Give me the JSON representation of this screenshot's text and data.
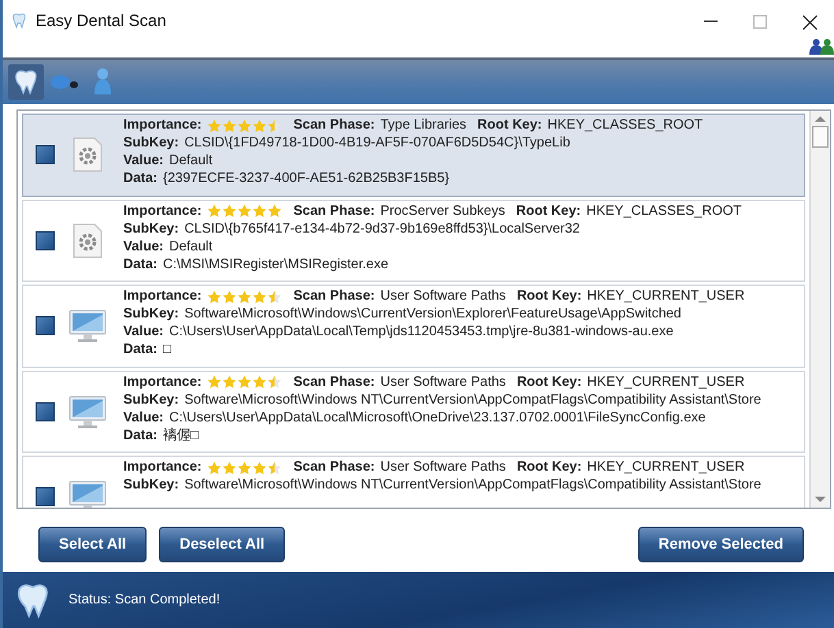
{
  "window": {
    "title": "Easy Dental Scan"
  },
  "toolbar": {
    "tabs": [
      {
        "selected": true
      },
      {
        "selected": false
      },
      {
        "selected": false
      }
    ]
  },
  "results": [
    {
      "selected": true,
      "lines": [
        [
          {
            "kind": "rating",
            "label": "Importance:",
            "stars": 4.5
          },
          {
            "kind": "text",
            "label": "Scan Phase:",
            "value": "Type Libraries"
          },
          {
            "kind": "text",
            "label": "Root Key:",
            "value": "HKEY_CLASSES_ROOT"
          }
        ],
        [
          {
            "kind": "text",
            "label": "SubKey:",
            "value": "CLSID\\{1FD49718-1D00-4B19-AF5F-070AF6D5D54C}\\TypeLib"
          }
        ],
        [
          {
            "kind": "text",
            "label": "Value:",
            "value": "Default"
          }
        ],
        [
          {
            "kind": "text",
            "label": "Data:",
            "value": "{2397ECFE-3237-400F-AE51-62B25B3F15B5}"
          }
        ]
      ]
    },
    {
      "selected": false,
      "lines": [
        [
          {
            "kind": "rating",
            "label": "Importance:",
            "stars": 5
          },
          {
            "kind": "text",
            "label": "Scan Phase:",
            "value": "ProcServer Subkeys"
          },
          {
            "kind": "text",
            "label": "Root Key:",
            "value": "HKEY_CLASSES_ROOT"
          }
        ],
        [
          {
            "kind": "text",
            "label": "SubKey:",
            "value": "CLSID\\{b765f417-e134-4b72-9d37-9b169e8ffd53}\\LocalServer32"
          }
        ],
        [
          {
            "kind": "text",
            "label": "Value:",
            "value": "Default"
          }
        ],
        [
          {
            "kind": "text",
            "label": "Data:",
            "value": "C:\\MSI\\MSIRegister\\MSIRegister.exe"
          }
        ]
      ]
    },
    {
      "selected": false,
      "lines": [
        [
          {
            "kind": "rating",
            "label": "Importance:",
            "stars": 4.5
          },
          {
            "kind": "text",
            "label": "Scan Phase:",
            "value": "User Software Paths"
          },
          {
            "kind": "text",
            "label": "Root Key:",
            "value": "HKEY_CURRENT_USER"
          }
        ],
        [
          {
            "kind": "text",
            "label": "SubKey:",
            "value": "Software\\Microsoft\\Windows\\CurrentVersion\\Explorer\\FeatureUsage\\AppSwitched"
          }
        ],
        [
          {
            "kind": "text",
            "label": "Value:",
            "value": "C:\\Users\\User\\AppData\\Local\\Temp\\jds1120453453.tmp\\jre-8u381-windows-au.exe"
          }
        ],
        [
          {
            "kind": "text",
            "label": "Data:",
            "value": "□"
          }
        ]
      ]
    },
    {
      "selected": false,
      "lines": [
        [
          {
            "kind": "rating",
            "label": "Importance:",
            "stars": 4.5
          },
          {
            "kind": "text",
            "label": "Scan Phase:",
            "value": "User Software Paths"
          },
          {
            "kind": "text",
            "label": "Root Key:",
            "value": "HKEY_CURRENT_USER"
          }
        ],
        [
          {
            "kind": "text",
            "label": "SubKey:",
            "value": "Software\\Microsoft\\Windows NT\\CurrentVersion\\AppCompatFlags\\Compatibility Assistant\\Store"
          }
        ],
        [
          {
            "kind": "text",
            "label": "Value:",
            "value": "C:\\Users\\User\\AppData\\Local\\Microsoft\\OneDrive\\23.137.0702.0001\\FileSyncConfig.exe"
          }
        ],
        [
          {
            "kind": "text",
            "label": "Data:",
            "value": "褵偓□"
          }
        ]
      ]
    },
    {
      "selected": false,
      "lines": [
        [
          {
            "kind": "rating",
            "label": "Importance:",
            "stars": 4.5
          },
          {
            "kind": "text",
            "label": "Scan Phase:",
            "value": "User Software Paths"
          },
          {
            "kind": "text",
            "label": "Root Key:",
            "value": "HKEY_CURRENT_USER"
          }
        ],
        [
          {
            "kind": "text",
            "label": "SubKey:",
            "value": "Software\\Microsoft\\Windows NT\\CurrentVersion\\AppCompatFlags\\Compatibility Assistant\\Store"
          }
        ]
      ]
    }
  ],
  "buttons": [
    "Select All",
    "Deselect All",
    "Remove Selected"
  ],
  "status_bar": {
    "text": "Status: Scan Completed!"
  }
}
